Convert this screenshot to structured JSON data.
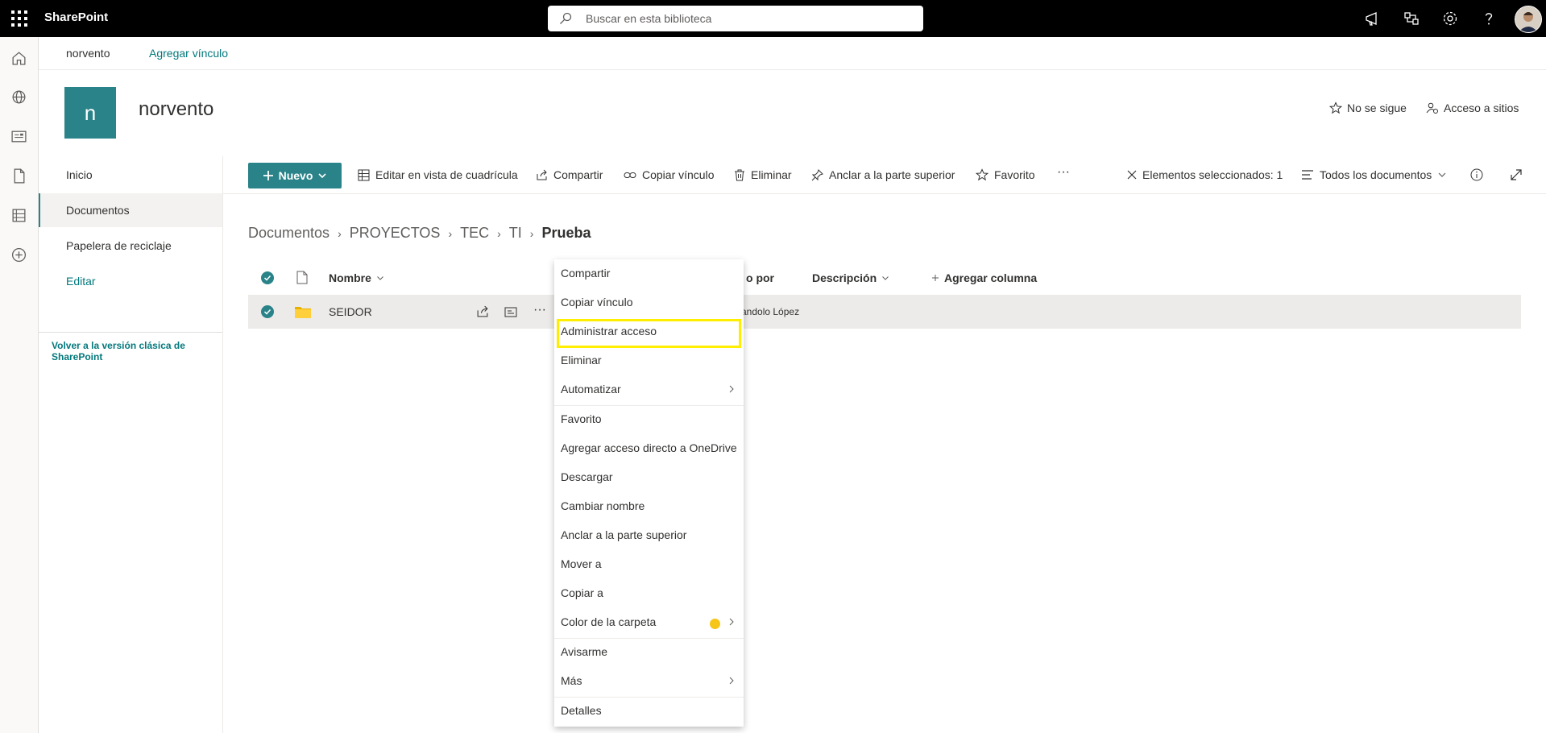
{
  "topbar": {
    "brand": "SharePoint",
    "search_placeholder": "Buscar en esta biblioteca"
  },
  "site_nav": {
    "site_link": "norvento",
    "add_link": "Agregar vínculo"
  },
  "site_header": {
    "logo_letter": "n",
    "title": "norvento",
    "follow": "No se sigue",
    "site_access": "Acceso a sitios"
  },
  "left_nav": {
    "items": [
      "Inicio",
      "Documentos",
      "Papelera de reciclaje"
    ],
    "edit": "Editar",
    "classic": "Volver a la versión clásica de SharePoint"
  },
  "command_bar": {
    "new": "Nuevo",
    "grid_view": "Editar en vista de cuadrícula",
    "share": "Compartir",
    "copy_link": "Copiar vínculo",
    "delete": "Eliminar",
    "pin": "Anclar a la parte superior",
    "favorite": "Favorito",
    "more": "···",
    "selected": "Elementos seleccionados: 1",
    "view": "Todos los documentos"
  },
  "breadcrumb": {
    "items": [
      "Documentos",
      "PROYECTOS",
      "TEC",
      "TI"
    ],
    "current": "Prueba"
  },
  "list": {
    "col_name": "Nombre",
    "col_modified_by": "o por",
    "col_description": "Descripción",
    "add_column": "Agregar columna",
    "row_name": "SEIDOR",
    "row_modified_by": "andolo López"
  },
  "context_menu": {
    "items": {
      "share": "Compartir",
      "copy_link": "Copiar vínculo",
      "manage_access": "Administrar acceso",
      "delete": "Eliminar",
      "automate": "Automatizar",
      "favorite": "Favorito",
      "onedrive": "Agregar acceso directo a OneDrive",
      "download": "Descargar",
      "rename": "Cambiar nombre",
      "pin": "Anclar a la parte superior",
      "move": "Mover a",
      "copy": "Copiar a",
      "folder_color": "Color de la carpeta",
      "alert": "Avisarme",
      "more": "Más",
      "details": "Detalles"
    },
    "highlighted": "Administrar acceso",
    "folder_color_swatch": "#f5c518"
  },
  "colors": {
    "accent": "#2a8388",
    "link": "#03787c",
    "highlight": "#ffee00"
  }
}
